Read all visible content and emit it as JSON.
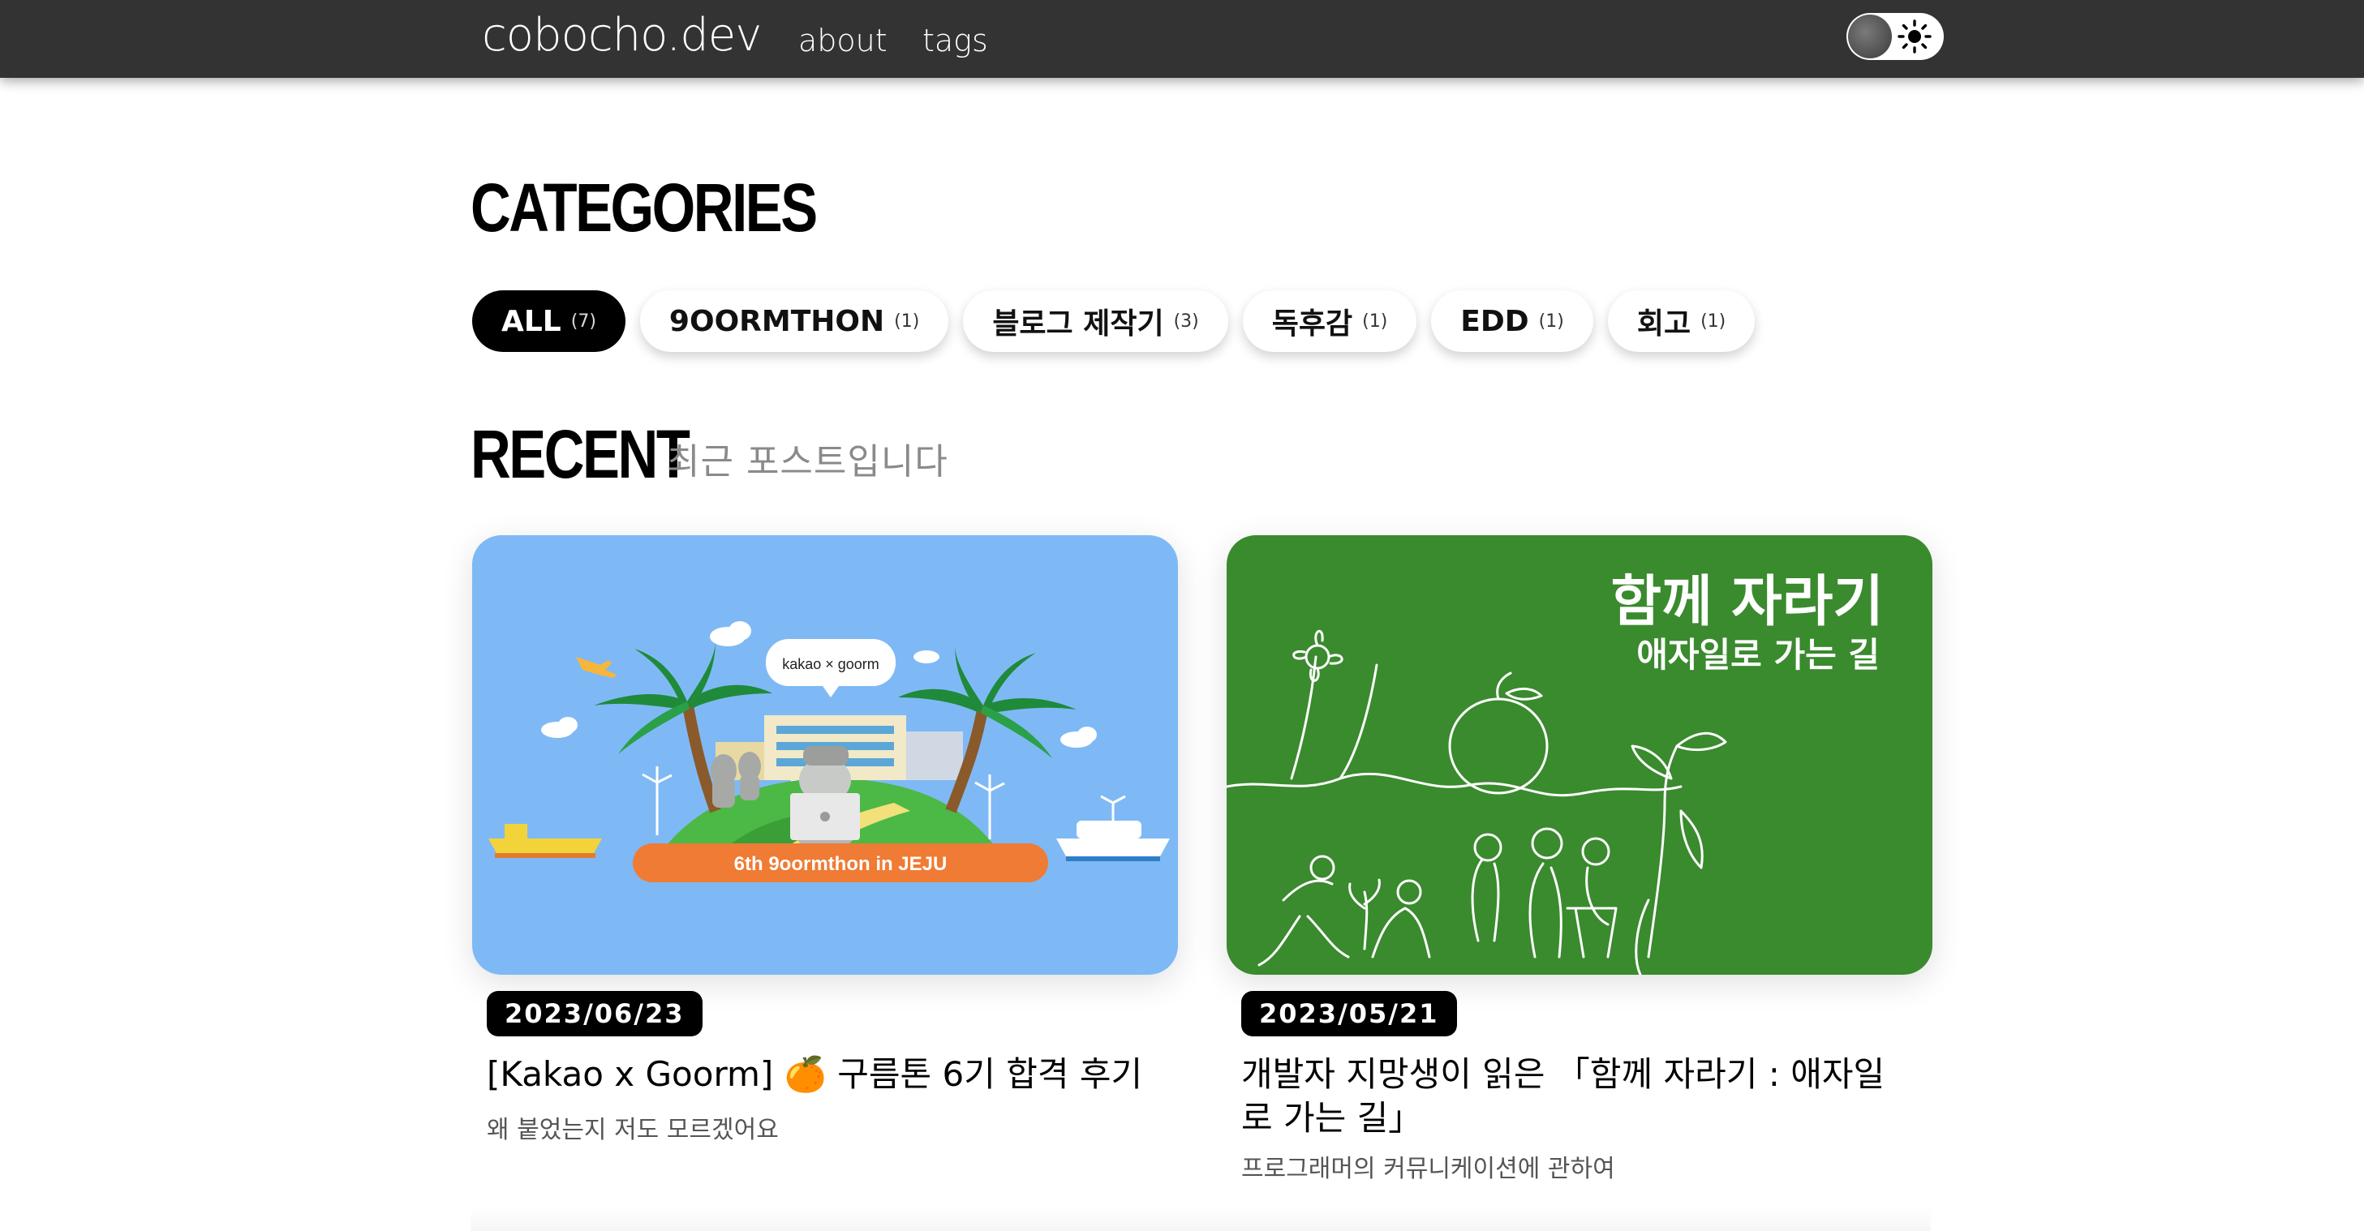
{
  "header": {
    "logo": "cobocho.dev",
    "nav": [
      "about",
      "tags"
    ],
    "theme_toggle_icon": "sun-icon"
  },
  "categories": {
    "title": "CATEGORIES",
    "items": [
      {
        "label": "ALL",
        "count": "(7)",
        "active": true
      },
      {
        "label": "9OORMTHON",
        "count": "(1)",
        "active": false
      },
      {
        "label": "블로그 제작기",
        "count": "(3)",
        "active": false
      },
      {
        "label": "독후감",
        "count": "(1)",
        "active": false
      },
      {
        "label": "EDD",
        "count": "(1)",
        "active": false
      },
      {
        "label": "회고",
        "count": "(1)",
        "active": false
      }
    ]
  },
  "recent": {
    "title": "RECENT",
    "subtitle": "최근 포스트입니다",
    "posts": [
      {
        "date": "2023/06/23",
        "title": "[Kakao x Goorm] 🍊 구름톤 6기 합격 후기",
        "description": "왜 붙었는지 저도 모르겠어요",
        "thumbnail": {
          "bubble_text": "kakao × goorm",
          "banner_text": "6th 9oormthon in JEJU",
          "background": "#7fb9f5"
        }
      },
      {
        "date": "2023/05/21",
        "title": "개발자 지망생이 읽은 「함께 자라기 : 애자일로 가는 길」",
        "description": "프로그래머의 커뮤니케이션에 관하여",
        "thumbnail": {
          "headline": "함께 자라기",
          "subheadline": "애자일로 가는 길",
          "background": "#3a8a2e"
        }
      }
    ]
  }
}
